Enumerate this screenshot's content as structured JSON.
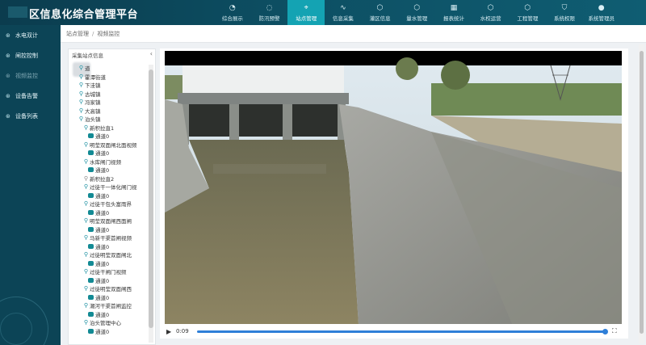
{
  "header": {
    "title": "区信息化综合管理平台",
    "nav": [
      {
        "label": "综合展示",
        "icon": "gauge-icon"
      },
      {
        "label": "防汛预警",
        "icon": "bell-icon"
      },
      {
        "label": "站点管理",
        "icon": "marker-icon",
        "active": true
      },
      {
        "label": "信息采集",
        "icon": "pulse-icon"
      },
      {
        "label": "灌区信息",
        "icon": "cube-icon"
      },
      {
        "label": "量水管理",
        "icon": "cube-icon"
      },
      {
        "label": "报表统计",
        "icon": "calendar-icon"
      },
      {
        "label": "水权运营",
        "icon": "cube-icon"
      },
      {
        "label": "工程管理",
        "icon": "cube-icon"
      },
      {
        "label": "系统权限",
        "icon": "shield-icon"
      },
      {
        "label": "系统管理员",
        "icon": "user-icon"
      }
    ]
  },
  "sidebar": {
    "items": [
      {
        "label": "水电双计",
        "dim": false
      },
      {
        "label": "闸控控制",
        "dim": false
      },
      {
        "label": "视频监控",
        "dim": true
      },
      {
        "label": "设备告警",
        "dim": false
      },
      {
        "label": "设备列表",
        "dim": false
      }
    ]
  },
  "breadcrumb": {
    "root": "站点管理",
    "separator": "/",
    "current": "视频监控"
  },
  "tree": {
    "heading": "采集站点信息",
    "collapse_glyph": "‹",
    "nodes": [
      {
        "label": "道",
        "indent": 1,
        "kind": "site"
      },
      {
        "label": "霍潭街道",
        "indent": 1,
        "kind": "site"
      },
      {
        "label": "下洼镇",
        "indent": 1,
        "kind": "site"
      },
      {
        "label": "古城镇",
        "indent": 1,
        "kind": "site"
      },
      {
        "label": "冯家镇",
        "indent": 1,
        "kind": "site"
      },
      {
        "label": "大高镇",
        "indent": 1,
        "kind": "site"
      },
      {
        "label": "泊头镇",
        "indent": 1,
        "kind": "site"
      },
      {
        "label": "新积拉直1",
        "indent": 2,
        "kind": "site"
      },
      {
        "label": "通道0",
        "indent": 3,
        "kind": "channel"
      },
      {
        "label": "明莹双面闸北面视频",
        "indent": 2,
        "kind": "site"
      },
      {
        "label": "通道0",
        "indent": 3,
        "kind": "channel"
      },
      {
        "label": "水库闸门视频",
        "indent": 2,
        "kind": "site"
      },
      {
        "label": "通道0",
        "indent": 3,
        "kind": "channel"
      },
      {
        "label": "新积拉直2",
        "indent": 2,
        "kind": "offline"
      },
      {
        "label": "过徒干一体化闸门视",
        "indent": 2,
        "kind": "site"
      },
      {
        "label": "通道0",
        "indent": 3,
        "kind": "channel"
      },
      {
        "label": "过徒干包头富雨界",
        "indent": 2,
        "kind": "site"
      },
      {
        "label": "通道0",
        "indent": 3,
        "kind": "channel"
      },
      {
        "label": "明莹双面闸西面闸",
        "indent": 2,
        "kind": "site"
      },
      {
        "label": "通道0",
        "indent": 3,
        "kind": "channel"
      },
      {
        "label": "马新干渠首闸视频",
        "indent": 2,
        "kind": "site"
      },
      {
        "label": "通道0",
        "indent": 3,
        "kind": "channel"
      },
      {
        "label": "过徒明莹双面闸北",
        "indent": 2,
        "kind": "site"
      },
      {
        "label": "通道0",
        "indent": 3,
        "kind": "channel"
      },
      {
        "label": "过徒干闸门视频",
        "indent": 2,
        "kind": "site"
      },
      {
        "label": "通道0",
        "indent": 3,
        "kind": "channel"
      },
      {
        "label": "过徒明莹双面闸西",
        "indent": 2,
        "kind": "site"
      },
      {
        "label": "通道0",
        "indent": 3,
        "kind": "channel"
      },
      {
        "label": "潮河干渠首闸监控",
        "indent": 2,
        "kind": "site"
      },
      {
        "label": "通道0",
        "indent": 3,
        "kind": "channel"
      },
      {
        "label": "泊头管理中心",
        "indent": 2,
        "kind": "site"
      },
      {
        "label": "通道0",
        "indent": 3,
        "kind": "channel"
      }
    ]
  },
  "player": {
    "time": "0:09",
    "progress": 1.0,
    "play_glyph": "▶",
    "fullscreen_glyph": "⛶"
  },
  "colors": {
    "header": "#0d4f63",
    "active_tab": "#14a3b3",
    "sidebar": "#0c4456",
    "accent": "#1a8fa0",
    "progress": "#2f7fd8"
  }
}
